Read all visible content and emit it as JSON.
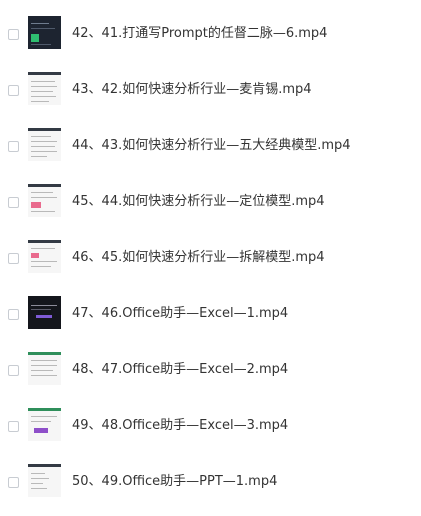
{
  "files": [
    {
      "name": "42、41.打通写Prompt的任督二脉—6.mp4",
      "thumb": "dark"
    },
    {
      "name": "43、42.如何快速分析行业—麦肯锡.mp4",
      "thumb": "doc"
    },
    {
      "name": "44、43.如何快速分析行业—五大经典模型.mp4",
      "thumb": "doc"
    },
    {
      "name": "45、44.如何快速分析行业—定位模型.mp4",
      "thumb": "doc-pink"
    },
    {
      "name": "46、45.如何快速分析行业—拆解模型.mp4",
      "thumb": "doc-pink"
    },
    {
      "name": "47、46.Office助手—Excel—1.mp4",
      "thumb": "dark"
    },
    {
      "name": "48、47.Office助手—Excel—2.mp4",
      "thumb": "sheet"
    },
    {
      "name": "49、48.Office助手—Excel—3.mp4",
      "thumb": "sheet-purple"
    },
    {
      "name": "50、49.Office助手—PPT—1.mp4",
      "thumb": "doc"
    }
  ],
  "colors": {
    "text": "#333333",
    "checkbox_border": "#c8ccd2",
    "background": "#ffffff"
  }
}
